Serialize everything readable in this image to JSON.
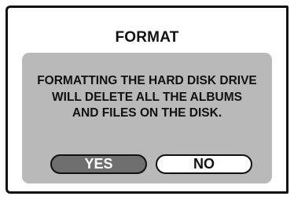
{
  "dialog": {
    "title": "FORMAT",
    "message_lines": [
      "FORMATTING THE HARD DISK DRIVE",
      "WILL DELETE ALL THE ALBUMS",
      "AND FILES ON THE DISK."
    ],
    "buttons": {
      "yes_label": "YES",
      "no_label": "NO",
      "selected": "YES"
    }
  },
  "colors": {
    "panel": "#b9b9b9",
    "selected_button": "#6f6f6f",
    "unselected_button": "#ffffff",
    "border": "#111111"
  }
}
